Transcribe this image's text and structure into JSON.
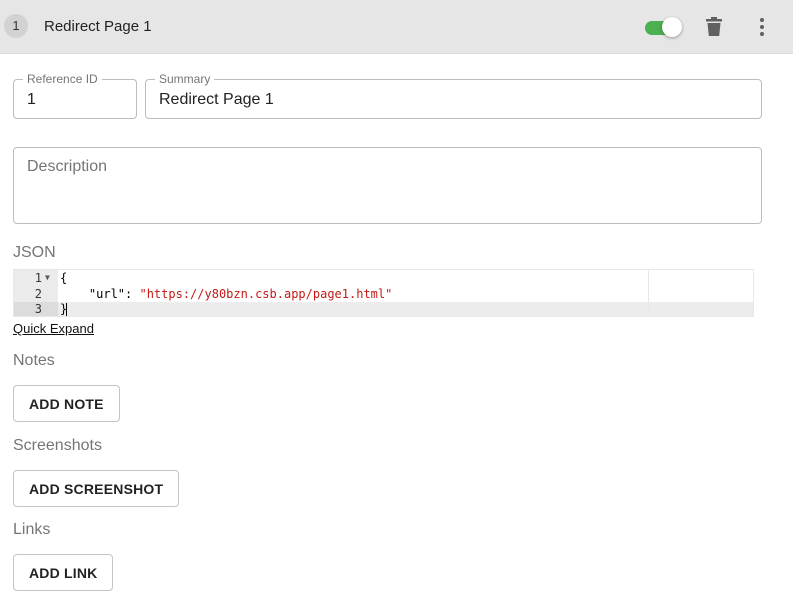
{
  "header": {
    "index": "1",
    "title": "Redirect Page 1",
    "enabled": true,
    "icons": {
      "toggle": "toggle-switch-on",
      "delete": "trash-icon",
      "more": "more-vertical-icon"
    },
    "colors": {
      "toggle_on": "#4caf50",
      "header_bg": "#e6e6e6"
    }
  },
  "form": {
    "reference_id": {
      "label": "Reference ID",
      "value": "1"
    },
    "summary": {
      "label": "Summary",
      "value": "Redirect Page 1"
    },
    "description": {
      "placeholder": "Description"
    }
  },
  "json_editor": {
    "label": "JSON",
    "line_numbers": [
      "1",
      "2",
      "3"
    ],
    "lines": {
      "l1": "{",
      "l2_key": "\"url\"",
      "l2_colon": ": ",
      "l2_value": "\"https://y80bzn.csb.app/page1.html\"",
      "l3": "}"
    },
    "quick_expand": "Quick Expand"
  },
  "notes": {
    "label": "Notes",
    "button": "ADD NOTE"
  },
  "screenshots": {
    "label": "Screenshots",
    "button": "ADD SCREENSHOT"
  },
  "links": {
    "label": "Links",
    "button": "ADD LINK"
  }
}
